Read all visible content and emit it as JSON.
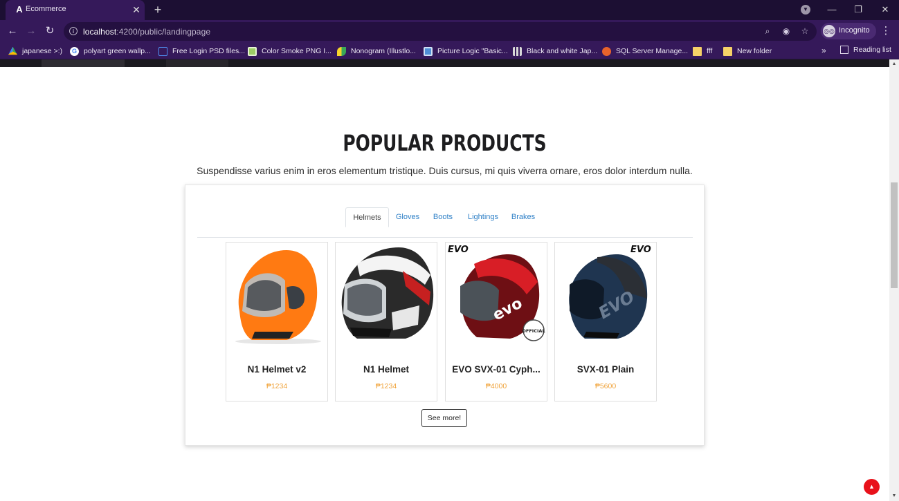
{
  "browser": {
    "tab_title": "Ecommerce",
    "tab_favicon": "A",
    "url_host": "localhost",
    "url_rest": ":4200/public/landingpage",
    "incognito_label": "Incognito",
    "bookmarks": [
      {
        "label": "japanese >:)",
        "icon": "drive-icon",
        "color": "#3aa757"
      },
      {
        "label": "polyart green wallp...",
        "icon": "google-icon",
        "color": "#ffffff"
      },
      {
        "label": "Free Login PSD files...",
        "icon": "square-outline-icon",
        "color": "#2d6cdf"
      },
      {
        "label": "Color Smoke PNG I...",
        "icon": "image-icon",
        "color": "#9ccc65"
      },
      {
        "label": "Nonogram (Illustlo...",
        "icon": "leaf-icon",
        "color": "#f7d52a"
      },
      {
        "label": "Picture Logic \"Basic...",
        "icon": "picture-icon",
        "color": "#4f8fd6"
      },
      {
        "label": "Black and white Jap...",
        "icon": "building-icon",
        "color": "#d8d8d8"
      },
      {
        "label": "SQL Server Manage...",
        "icon": "db-icon",
        "color": "#e8632b"
      },
      {
        "label": "fff",
        "icon": "folder-icon",
        "color": "#f6d268"
      },
      {
        "label": "New folder",
        "icon": "folder-icon",
        "color": "#f6d268"
      }
    ],
    "bookmarks_more": "»",
    "reading_list_label": "Reading list"
  },
  "section": {
    "title": "POPULAR PRODUCTS",
    "subtitle": "Suspendisse varius enim in eros elementum tristique. Duis cursus, mi quis viverra ornare, eros dolor interdum nulla."
  },
  "tabs": [
    {
      "label": "Helmets",
      "active": true
    },
    {
      "label": "Gloves",
      "active": false
    },
    {
      "label": "Boots",
      "active": false
    },
    {
      "label": "Lightings",
      "active": false
    },
    {
      "label": "Brakes",
      "active": false
    }
  ],
  "products": [
    {
      "name": "N1 Helmet v2",
      "price": "₱1234",
      "image": "orange-helmet"
    },
    {
      "name": "N1 Helmet",
      "price": "₱1234",
      "image": "black-white-helmet"
    },
    {
      "name": "EVO SVX-01 Cyph...",
      "price": "₱4000",
      "image": "red-evo-helmet",
      "brand_mark": "EVO",
      "stamp": "OFFICIAL"
    },
    {
      "name": "SVX-01 Plain",
      "price": "₱5600",
      "image": "blue-evo-helmet",
      "brand_mark": "EVO"
    }
  ],
  "see_more_label": "See more!",
  "colors": {
    "price": "#f0a33a",
    "tab_link": "#2f80c7",
    "scroll_top_button": "#e8111a"
  }
}
